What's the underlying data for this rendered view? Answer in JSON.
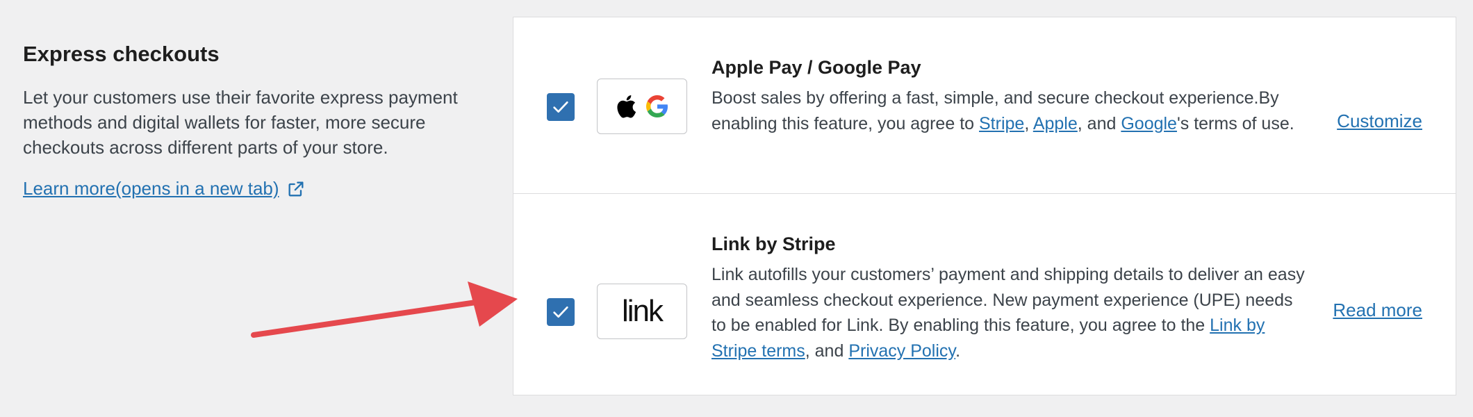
{
  "section": {
    "title": "Express checkouts",
    "description": "Let your customers use their favorite express payment methods and digital wallets for faster, more secure checkouts across different parts of your store.",
    "learn_more": "Learn more(opens in a new tab)"
  },
  "methods": [
    {
      "title": "Apple Pay / Google Pay",
      "desc_part1": "Boost sales by offering a fast, simple, and secure checkout experience.By enabling this feature, you agree to ",
      "link_stripe": "Stripe",
      "sep1": ", ",
      "link_apple": "Apple",
      "sep2": ", and ",
      "link_google": "Google",
      "desc_tail": "'s terms of use.",
      "action": "Customize",
      "checked": true,
      "icon": "apple-google-logos"
    },
    {
      "title": "Link by Stripe",
      "desc_part1": "Link autofills your customers’ payment and shipping details to deliver an easy and seamless checkout experience. New payment experience (UPE) needs to be enabled for Link. By enabling this feature, you agree to the ",
      "link_terms": "Link by Stripe terms",
      "sep1": ", and ",
      "link_privacy": "Privacy Policy",
      "desc_tail": ".",
      "action": "Read more",
      "checked": true,
      "logo_text": "link"
    }
  ],
  "colors": {
    "accent": "#2f70b0",
    "link": "#2271b1",
    "arrow": "#e5484d",
    "background": "#f0f0f1"
  }
}
